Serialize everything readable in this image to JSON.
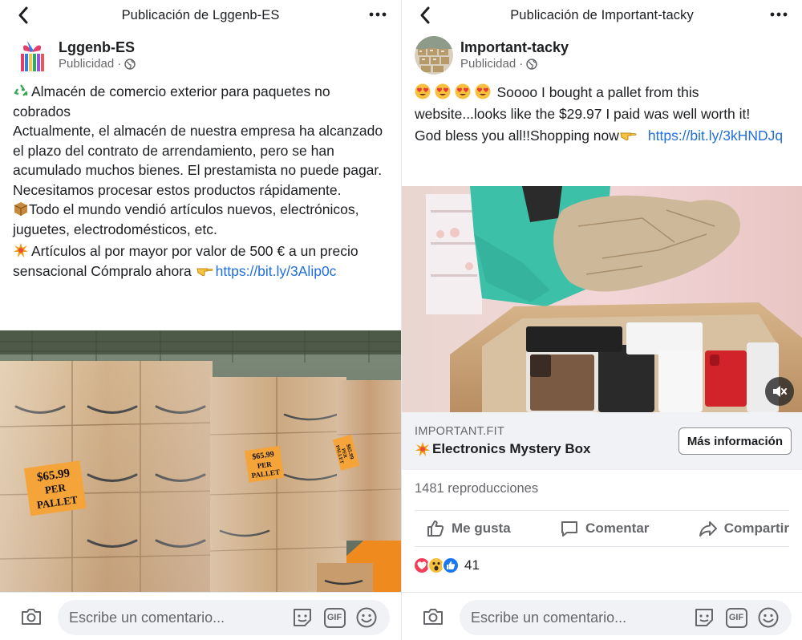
{
  "colors": {
    "link": "#216fdb",
    "muted": "#65676b",
    "text": "#1c1e21",
    "divider": "#e4e6eb"
  },
  "left": {
    "title": "Publicación de Lggenb-ES",
    "page_name": "Lggenb-ES",
    "sponsored": "Publicidad",
    "sponsored_sep": "·",
    "text": {
      "line1": "Almacén de comercio exterior para paquetes no cobrados",
      "line2": "Actualmente, el almacén de nuestra empresa ha alcanzado el plazo del contrato de arrendamiento, pero se han acumulado muchos bienes. El prestamista no puede pagar. Necesitamos procesar estos productos rápidamente.",
      "line3": "Todo el mundo vendió artículos nuevos, electrónicos, juguetes, electrodomésticos, etc.",
      "line4": "Artículos al por mayor por valor de 500 € a un precio sensacional Cómpralo ahora",
      "link": "https://bit.ly/3Alip0c"
    },
    "image_text": {
      "sign_left": [
        "$65.99",
        "PER",
        "PALLET"
      ],
      "sign_mid": [
        "$65.99",
        "PER",
        "PALLET"
      ],
      "sign_right": [
        "$65.99",
        "PER",
        "PALLET"
      ]
    },
    "comment_placeholder": "Escribe un comentario...",
    "gif": "GIF"
  },
  "right": {
    "title": "Publicación de Important-tacky",
    "page_name": "Important-tacky",
    "sponsored": "Publicidad",
    "sponsored_sep": "·",
    "text": {
      "line1": "Soooo I bought a pallet from this website...looks like the $29.97 I paid was well worth it!",
      "line2": "God bless you all!!Shopping now",
      "link": "https://bit.ly/3kHNDJq"
    },
    "link_card": {
      "domain": "IMPORTANT.FIT",
      "title": "Electronics Mystery Box",
      "button": "Más información"
    },
    "views": "1481 reproducciones",
    "actions": {
      "like": "Me gusta",
      "comment": "Comentar",
      "share": "Compartir"
    },
    "reaction_count": "41",
    "comment_placeholder": "Escribe un comentario...",
    "gif": "GIF"
  }
}
